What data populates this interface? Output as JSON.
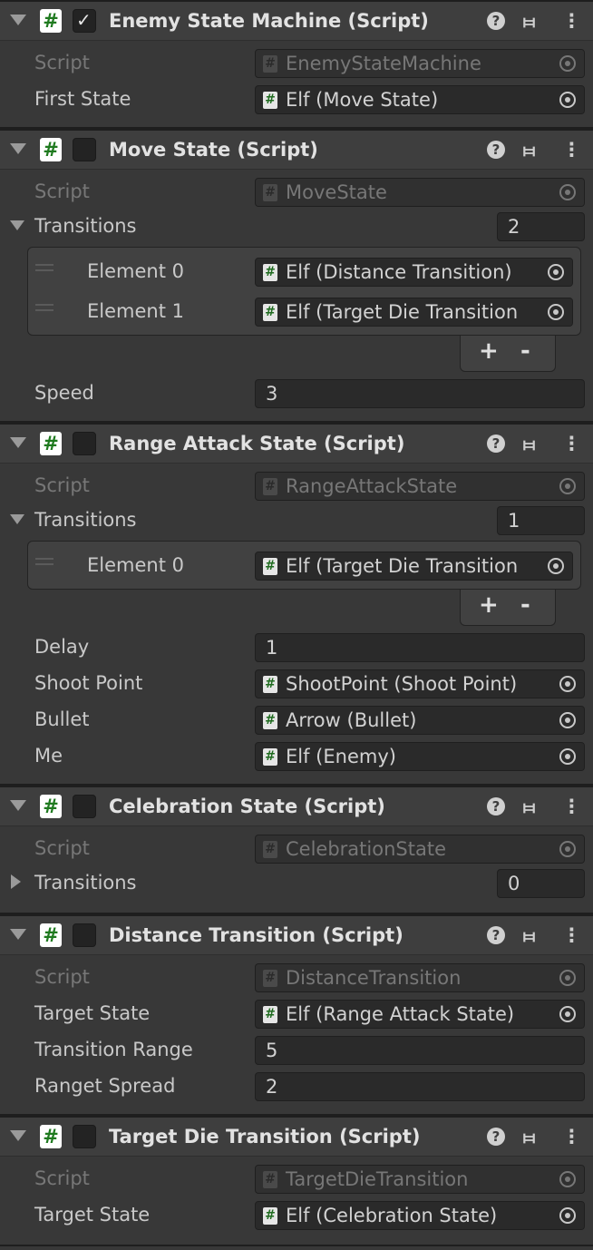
{
  "icons": {
    "script": "hash-icon",
    "help": "help-icon",
    "preset": "preset-icon",
    "menu": "kebab-menu-icon",
    "picker": "object-picker-icon"
  },
  "labels": {
    "script": "Script",
    "transitions": "Transitions",
    "plus": "+",
    "minus": "-"
  },
  "components": {
    "enemy_state_machine": {
      "title": "Enemy State Machine (Script)",
      "enabled": true,
      "script": "EnemyStateMachine",
      "first_state_label": "First State",
      "first_state_value": "Elf (Move State)"
    },
    "move_state": {
      "title": "Move State (Script)",
      "enabled": false,
      "script": "MoveState",
      "transitions_count": "2",
      "elements": [
        {
          "label": "Element 0",
          "value": "Elf (Distance Transition)"
        },
        {
          "label": "Element 1",
          "value": "Elf (Target Die Transition"
        }
      ],
      "speed_label": "Speed",
      "speed_value": "3"
    },
    "range_attack_state": {
      "title": "Range Attack State (Script)",
      "enabled": false,
      "script": "RangeAttackState",
      "transitions_count": "1",
      "elements": [
        {
          "label": "Element 0",
          "value": "Elf (Target Die Transition"
        }
      ],
      "delay_label": "Delay",
      "delay_value": "1",
      "shoot_point_label": "Shoot Point",
      "shoot_point_value": "ShootPoint (Shoot Point)",
      "bullet_label": "Bullet",
      "bullet_value": "Arrow (Bullet)",
      "me_label": "Me",
      "me_value": "Elf (Enemy)"
    },
    "celebration_state": {
      "title": "Celebration State (Script)",
      "enabled": false,
      "script": "CelebrationState",
      "transitions_count": "0"
    },
    "distance_transition": {
      "title": "Distance Transition (Script)",
      "enabled": false,
      "script": "DistanceTransition",
      "target_state_label": "Target State",
      "target_state_value": "Elf (Range Attack State)",
      "transition_range_label": "Transition Range",
      "transition_range_value": "5",
      "ranget_spread_label": "Ranget Spread",
      "ranget_spread_value": "2"
    },
    "target_die_transition": {
      "title": "Target Die Transition (Script)",
      "enabled": false,
      "script": "TargetDieTransition",
      "target_state_label": "Target State",
      "target_state_value": "Elf (Celebration State)"
    }
  }
}
